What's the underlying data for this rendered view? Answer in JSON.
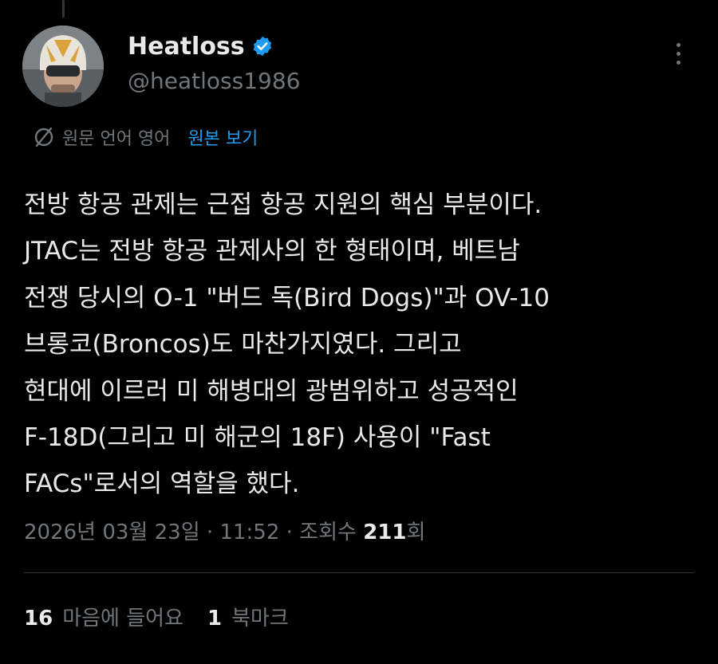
{
  "author": {
    "display_name": "Heatloss",
    "handle": "@heatloss1986",
    "verified": true
  },
  "translation": {
    "notice": "원문 언어 영어",
    "show_original": "원본 보기"
  },
  "tweet": {
    "lines": [
      "전방 항공 관제는 근접 항공 지원의 핵심 부분이다.",
      "JTAC는 전방 항공 관제사의 한 형태이며, 베트남",
      "전쟁 당시의 O-1 \"버드 독(Bird Dogs)\"과 OV-10",
      "브롱코(Broncos)도 마찬가지였다. 그리고",
      "현대에 이르러 미 해병대의 광범위하고 성공적인",
      "F-18D(그리고 미 해군의 18F) 사용이 \"Fast",
      "FACs\"로서의 역할을 했다."
    ]
  },
  "meta": {
    "date": "2026년 03월 23일",
    "separator": " · ",
    "time": "11:52",
    "views_label": "조회수",
    "views_count": "211",
    "views_suffix": "회"
  },
  "stats": {
    "likes_count": "16",
    "likes_label": "마음에 들어요",
    "bookmarks_count": "1",
    "bookmarks_label": "북마크"
  },
  "colors": {
    "background": "#000000",
    "primary_text": "#e7e9ea",
    "secondary_text": "#71767b",
    "link": "#1d9bf0",
    "verified_badge": "#1d9bf0"
  },
  "icons": {
    "verified": "verified-badge-icon",
    "more": "more-vertical-icon",
    "translate": "translate-icon"
  }
}
